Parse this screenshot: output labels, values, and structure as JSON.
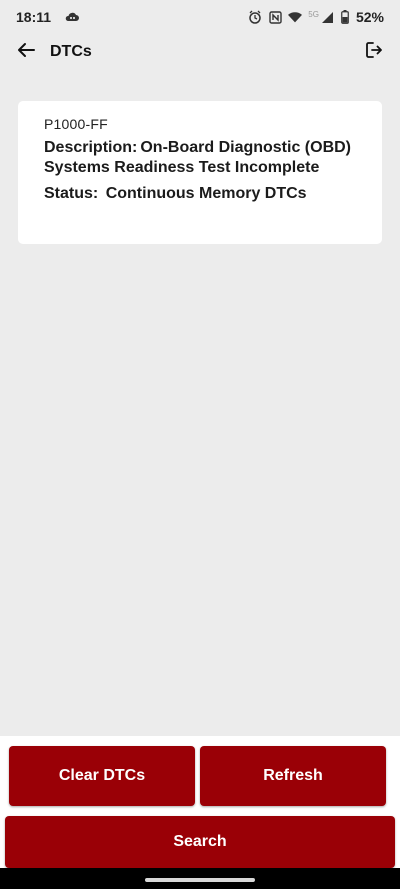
{
  "status_bar": {
    "time": "18:11",
    "network_label": "5G",
    "battery_percent": "52%",
    "icons": [
      "cloud-icon",
      "alarm-icon",
      "nfc-icon",
      "wifi-icon",
      "signal-icon",
      "battery-icon"
    ]
  },
  "app_bar": {
    "title": "DTCs",
    "back_icon": "arrow-left-icon",
    "logout_icon": "logout-icon"
  },
  "dtc": {
    "code": "P1000-FF",
    "description_label": "Description:",
    "description": "On-Board Diagnostic (OBD) Systems Readiness Test Incomplete",
    "status_label": "Status:",
    "status": "Continuous Memory DTCs"
  },
  "actions": {
    "clear_label": "Clear DTCs",
    "refresh_label": "Refresh",
    "search_label": "Search"
  },
  "colors": {
    "accent": "#9a0006",
    "background": "#ececec",
    "card": "#ffffff"
  }
}
